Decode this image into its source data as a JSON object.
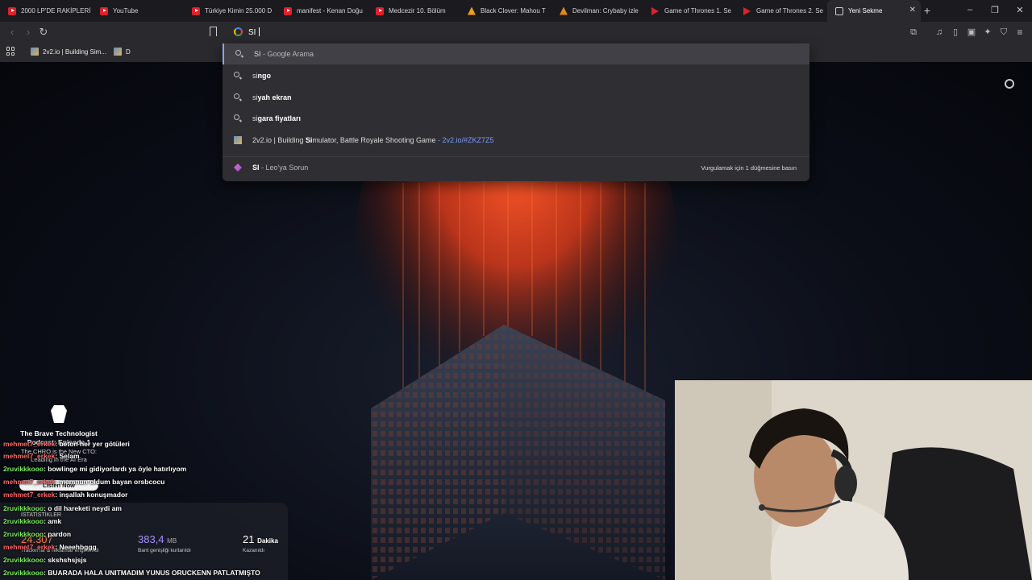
{
  "tabs": [
    {
      "title": "2000 LP'DE RAKİPLERİ",
      "icon": "youtube-icon"
    },
    {
      "title": "YouTube",
      "icon": "youtube-icon"
    },
    {
      "title": "Türkiye Kimin 25.000 D",
      "icon": "youtube-icon"
    },
    {
      "title": "manifest - Kenan Doğu",
      "icon": "youtube-icon"
    },
    {
      "title": "Medcezir 10. Bölüm",
      "icon": "youtube-icon"
    },
    {
      "title": "Black Clover: Mahou T",
      "icon": "crunchyroll-icon"
    },
    {
      "title": "Devilman: Crybaby izle",
      "icon": "devilman-icon"
    },
    {
      "title": "Game of Thrones 1. Se",
      "icon": "netflix-icon"
    },
    {
      "title": "Game of Thrones 2. Se",
      "icon": "netflix-icon"
    },
    {
      "title": "Yeni Sekme",
      "icon": "brave-icon"
    }
  ],
  "omnibox": {
    "value": "SI"
  },
  "bookmarks": [
    {
      "label": "2v2.io | Building Sim..."
    },
    {
      "label": "D"
    }
  ],
  "suggestions": [
    {
      "bold": "SI",
      "rest": " - Google Arama",
      "type": "search"
    },
    {
      "bold": "si",
      "rest": "ngo",
      "type": "search"
    },
    {
      "bold": "si",
      "rest": "yah ekran",
      "type": "search"
    },
    {
      "bold": "si",
      "rest": "gara fiyatları",
      "type": "search"
    },
    {
      "pre": "2v2.io | Building ",
      "bold": "Si",
      "rest": "mulator, Battle Royale Shooting Game",
      "url": " - 2v2.io/#ZKZ7Z5",
      "type": "site"
    },
    {
      "bold": "SI",
      "rest": " - Leo'ya Sorun",
      "hint": "Vurgulamak için 1 düğmesine basın",
      "type": "leo"
    }
  ],
  "podcast": {
    "title_line1": "The Brave Technologist",
    "title_line2": "Podcast: Episode 1",
    "sub_line1": "The CHRO is the New CTO:",
    "sub_line2": "Leading in the AI Era",
    "listen": "Listen Now"
  },
  "stats": {
    "header": "İSTATİSTİKLER",
    "trackers_value": "24.307",
    "trackers_label": "Tracker'lar & reklamlar engellendi",
    "bandwidth_value": "383,4",
    "bandwidth_unit": "MB",
    "bandwidth_label": "Bant genişliği kurtarıldı",
    "time_value": "21",
    "time_unit": "Dakika",
    "time_label": "Kazanıldı"
  },
  "chat": [
    {
      "user": "mehmet7_erkek",
      "msg": ": beton her yer götüleri",
      "color": "u2"
    },
    {
      "user": "mehmet7_erkek",
      "msg": ": Selam",
      "color": "u2"
    },
    {
      "user": "2ruvikkkooo",
      "msg": ": bowlinge mi gidiyorlardı ya öyle hatırlıyom",
      "color": "u1"
    },
    {
      "user": "mehmet7_erkek",
      "msg": ": memnun oldum bayan orsbcocu",
      "color": "u2"
    },
    {
      "user": "mehmet7_erkek",
      "msg": ": inşallah konuşmador",
      "color": "u2"
    },
    {
      "user": "2ruvikkkooo",
      "msg": ": o dil hareketi neydi am",
      "color": "u1"
    },
    {
      "user": "2ruvikkkooo",
      "msg": ": amk",
      "color": "u1"
    },
    {
      "user": "2ruvikkkooo",
      "msg": ": pardon",
      "color": "u1"
    },
    {
      "user": "mehmet7_erkek",
      "msg": ": Neeehbggg",
      "color": "u2"
    },
    {
      "user": "2ruvikkkooo",
      "msg": ": skshshsjsjs",
      "color": "u1"
    },
    {
      "user": "2ruvikkkooo",
      "msg": ": BUARADA HALA UNITMADIM YUNUS ORUCKENN PATLATMIŞTO",
      "color": "u1"
    }
  ]
}
